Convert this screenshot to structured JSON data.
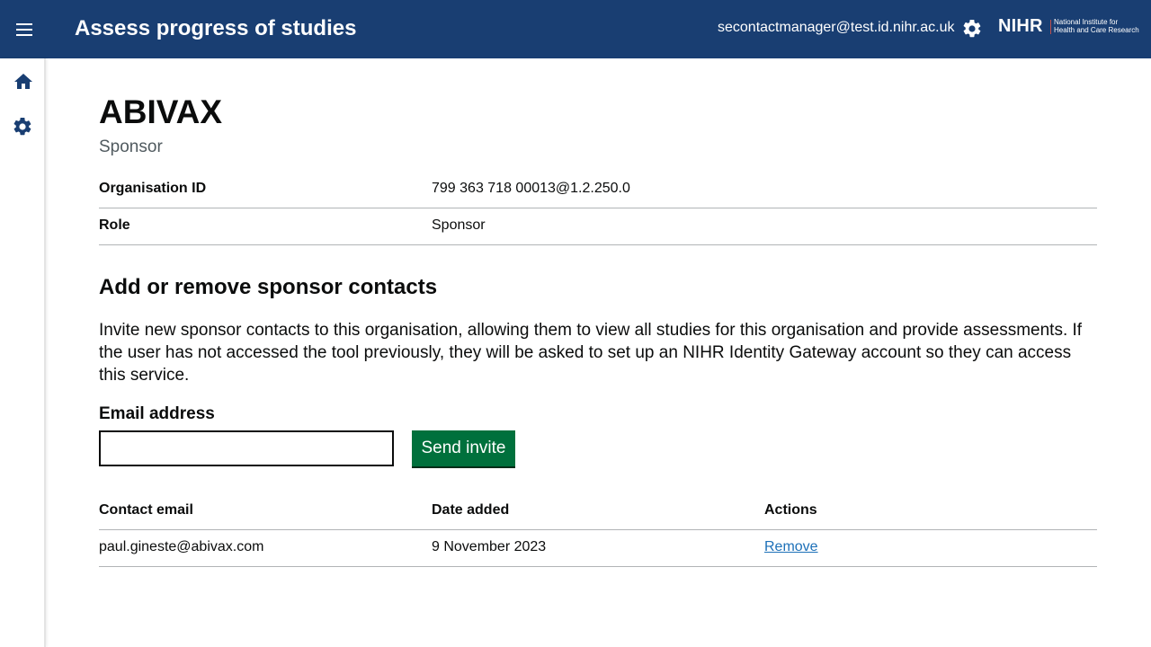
{
  "header": {
    "app_title": "Assess progress of studies",
    "user_email": "secontactmanager@test.id.nihr.ac.uk",
    "logo_text": "NIHR",
    "logo_subtext_1": "National Institute for",
    "logo_subtext_2": "Health and Care Research",
    "menu_icon": "hamburger-menu-icon",
    "settings_icon": "gear-icon"
  },
  "sidebar": {
    "items": [
      {
        "icon": "home-icon"
      },
      {
        "icon": "gear-icon"
      }
    ]
  },
  "organisation": {
    "name": "ABIVAX",
    "type": "Sponsor",
    "summary": [
      {
        "key": "Organisation ID",
        "value": "799 363 718 00013@1.2.250.0"
      },
      {
        "key": "Role",
        "value": "Sponsor"
      }
    ]
  },
  "contacts_section": {
    "title": "Add or remove sponsor contacts",
    "intro": "Invite new sponsor contacts to this organisation, allowing them to view all studies for this organisation and provide assessments. If the user has not accessed the tool previously, they will be asked to set up an NIHR Identity Gateway account so they can access this service.",
    "email_label": "Email address",
    "email_value": "",
    "send_label": "Send invite"
  },
  "contacts_table": {
    "headers": [
      "Contact email",
      "Date added",
      "Actions"
    ],
    "rows": [
      {
        "email": "paul.gineste@abivax.com",
        "date_added": "9 November 2023",
        "action": "Remove"
      }
    ]
  },
  "colors": {
    "header_bg": "#193e72",
    "button_green": "#00703c",
    "link_blue": "#1d70b8"
  }
}
